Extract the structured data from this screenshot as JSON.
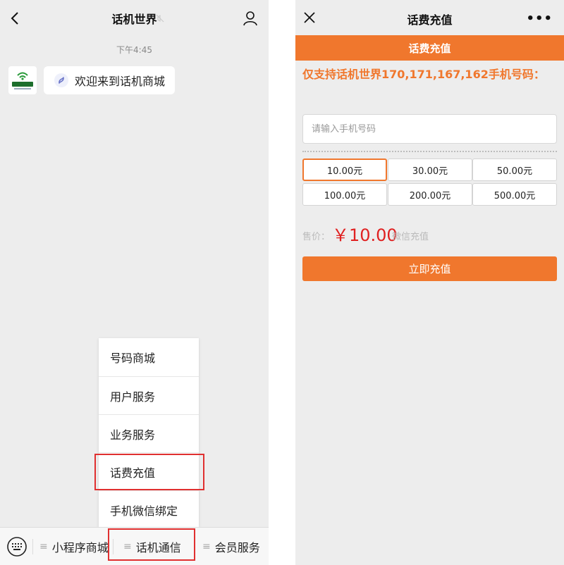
{
  "left": {
    "header": {
      "title": "话机世界",
      "back_icon": "chevron-left-icon",
      "mute_icon": "mute-icon",
      "profile_icon": "person-icon"
    },
    "time": "下午4:45",
    "message": {
      "avatar_icon": "huaji-world-logo-icon",
      "text": "欢迎来到话机商城",
      "link_icon": "mini-program-icon"
    },
    "menu": {
      "items": [
        {
          "label": "号码商城"
        },
        {
          "label": "用户服务"
        },
        {
          "label": "业务服务"
        },
        {
          "label": "话费充值"
        },
        {
          "label": "手机微信绑定"
        }
      ],
      "highlight_color": "#e03030"
    },
    "bottom_bar": {
      "keyboard_icon": "keyboard-icon",
      "tabs": [
        {
          "label": "小程序商城"
        },
        {
          "label": "话机通信"
        },
        {
          "label": "会员服务"
        }
      ],
      "tab_marker": "≡"
    }
  },
  "right": {
    "header": {
      "title": "话费充值",
      "close_icon": "close-icon",
      "more_label": "•••"
    },
    "banner": "话费充值",
    "support_text": "仅支持话机世界170,171,167,162手机号码：",
    "phone_input": {
      "placeholder": "请输入手机号码",
      "value": ""
    },
    "amounts": [
      {
        "label": "10.00元",
        "selected": true
      },
      {
        "label": "30.00元",
        "selected": false
      },
      {
        "label": "50.00元",
        "selected": false
      },
      {
        "label": "100.00元",
        "selected": false
      },
      {
        "label": "200.00元",
        "selected": false
      },
      {
        "label": "500.00元",
        "selected": false
      }
    ],
    "price_label": "售价：",
    "price_value": "￥10.00",
    "price_note": "微信充值",
    "submit_label": "立即充值",
    "accent_color": "#f0772d",
    "price_color": "#e02020"
  }
}
